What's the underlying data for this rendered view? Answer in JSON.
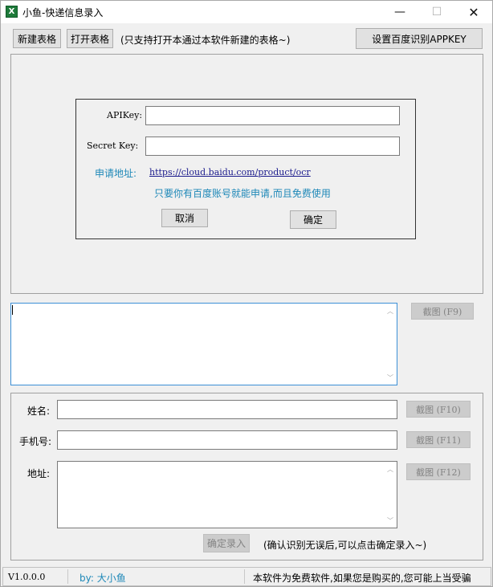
{
  "window": {
    "title": "小鱼-快递信息录入",
    "icon_letter": "X",
    "minimize": "—",
    "maximize": "☐",
    "close": "✕"
  },
  "toolbar": {
    "new_table": "新建表格",
    "open_table": "打开表格",
    "note": "(只支持打开本通过本软件新建的表格~)",
    "set_key": "设置百度识别APPKEY"
  },
  "dialog": {
    "apikey_label": "APIKey:",
    "apikey_value": "",
    "secret_label": "Secret Key:",
    "secret_value": "",
    "apply_label": "申请地址:",
    "apply_url": "https://cloud.baidu.com/product/ocr",
    "hint": "只要你有百度账号就能申请,而且免费使用",
    "cancel": "取消",
    "ok": "确定"
  },
  "ocr": {
    "text": "",
    "capture_button": "截图 (F9)"
  },
  "form": {
    "name_label": "姓名:",
    "name_value": "",
    "name_capture": "截图 (F10)",
    "phone_label": "手机号:",
    "phone_value": "",
    "phone_capture": "截图 (F11)",
    "address_label": "地址:",
    "address_value": "",
    "address_capture": "截图 (F12)",
    "submit": "确定录入",
    "submit_note": "(确认识别无误后,可以点击确定录入~)"
  },
  "status": {
    "version": "V1.0.0.0",
    "author": "by: 大小鱼",
    "notice": "本软件为免费软件,如果您是购买的,您可能上当受骗"
  },
  "colors": {
    "accent_blue": "#1e88b8",
    "focus_border": "#3c8fd6"
  }
}
